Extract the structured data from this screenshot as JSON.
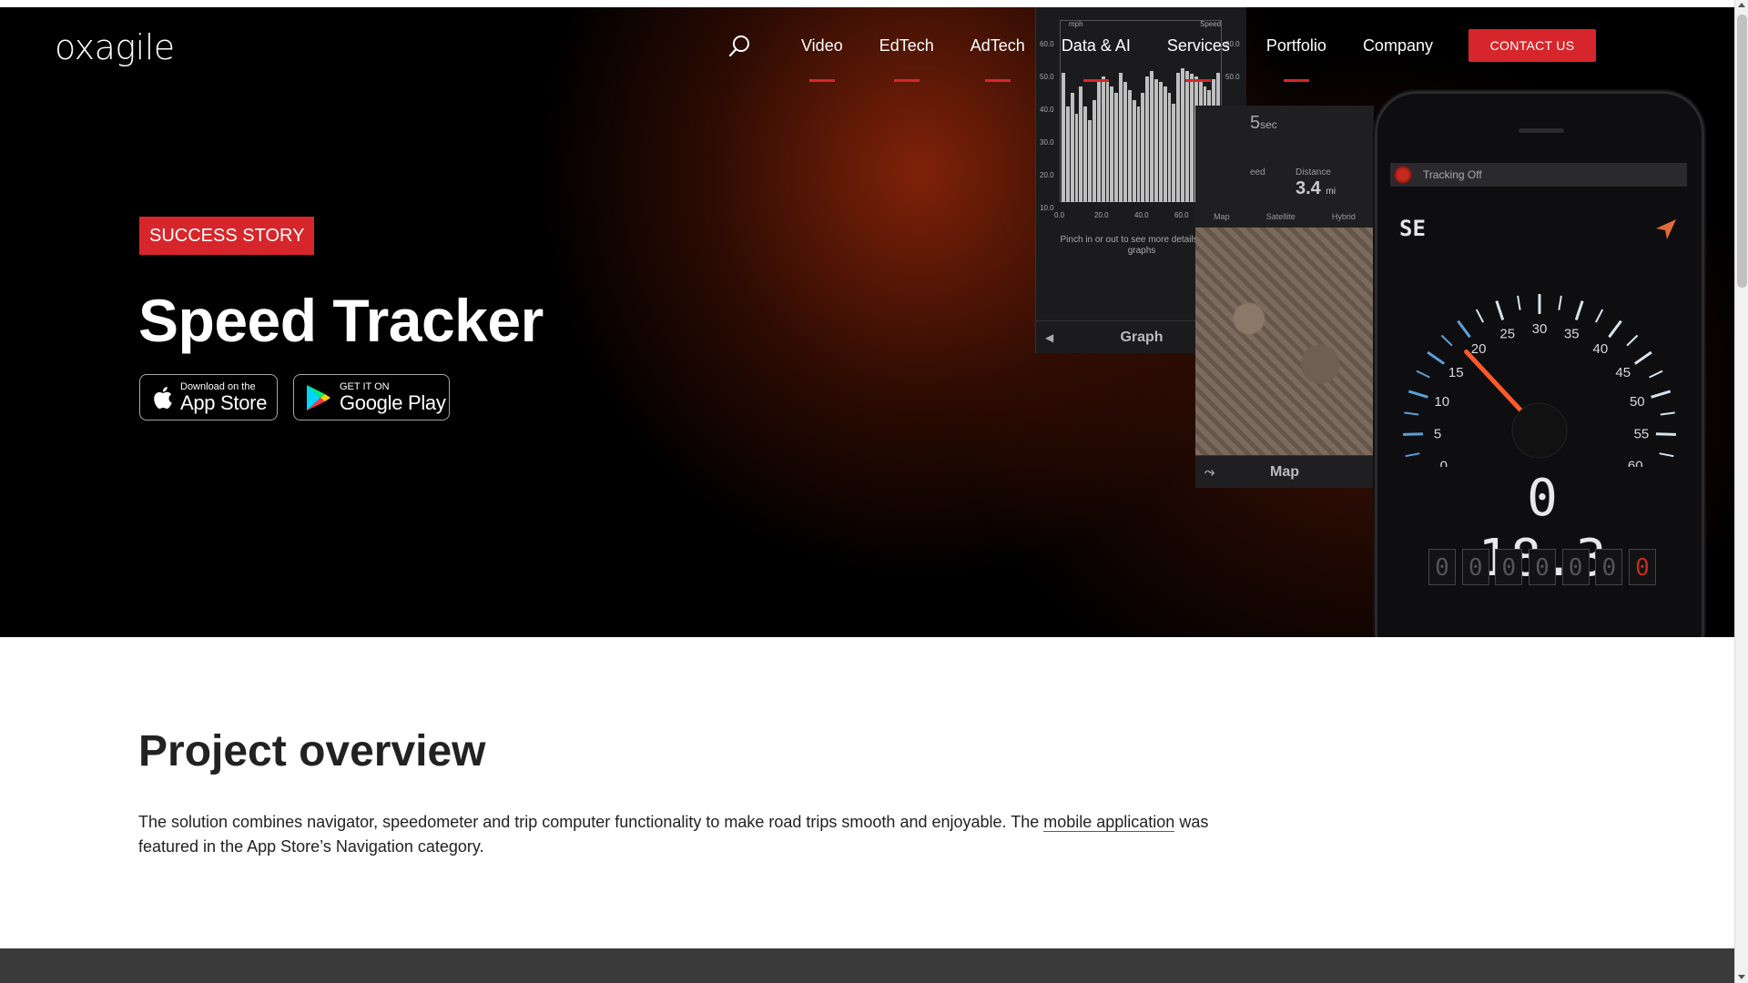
{
  "header": {
    "logo": "oxagile",
    "nav": [
      {
        "label": "Video",
        "underlined": true
      },
      {
        "label": "EdTech",
        "underlined": true
      },
      {
        "label": "AdTech",
        "underlined": true
      },
      {
        "label": "Data & AI",
        "underlined": true
      },
      {
        "label": "Services",
        "underlined": true
      },
      {
        "label": "Portfolio",
        "underlined": true
      },
      {
        "label": "Company",
        "underlined": false
      }
    ],
    "contact_label": "CONTACT US",
    "search_icon": "search-icon"
  },
  "hero": {
    "badge": "SUCCESS STORY",
    "title": "Speed Tracker",
    "appstore": {
      "small": "Download on the",
      "big": "App Store"
    },
    "gplay": {
      "small": "GET IT ON",
      "big": "Google Play"
    }
  },
  "graph_panel": {
    "y_unit": "mph",
    "y_right_label": "Speed",
    "y_ticks": [
      "60.0",
      "50.0",
      "40.0",
      "30.0",
      "20.0",
      "10.0"
    ],
    "x_ticks": [
      "0.0",
      "20.0",
      "40.0",
      "60.0",
      "80.0"
    ],
    "hint": "Pinch in or out to see more details of the graphs",
    "footer": "Graph"
  },
  "map_panel": {
    "time_value": "5",
    "time_unit": "sec",
    "speed_label": "eed",
    "distance_label": "Distance",
    "distance_value": "3.4",
    "distance_unit": "mi",
    "tabs": [
      "Map",
      "Satellite",
      "Hybrid"
    ],
    "footer": "Map"
  },
  "phone": {
    "tracking": "Tracking Off",
    "heading": "SE",
    "gauge_labels": [
      "0",
      "5",
      "10",
      "15",
      "20",
      "25",
      "30",
      "35",
      "40",
      "45",
      "50",
      "55",
      "60"
    ],
    "speed": "0 18.3",
    "odometer": [
      "0",
      "0",
      "0",
      "0",
      "0",
      "0",
      "0"
    ]
  },
  "overview": {
    "title": "Project overview",
    "text_before": "The solution combines navigator, speedometer and trip computer functionality to make road trips smooth and enjoyable. The ",
    "link": "mobile application",
    "text_after": " was featured in the App Store’s Navigation category."
  },
  "colors": {
    "accent": "#d7262b",
    "hero_bg": "#000000",
    "band": "#3a3a3a"
  }
}
